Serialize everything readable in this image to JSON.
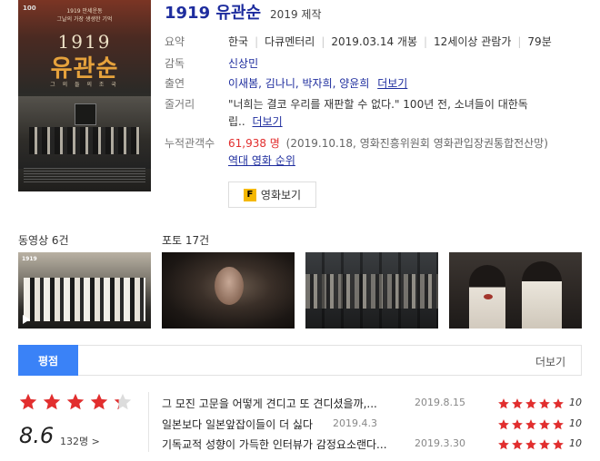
{
  "movie": {
    "title": "1919 유관순",
    "year_text": "2019 제작",
    "poster": {
      "corner": "100",
      "copy": "1919 만세운동\n그날의 가장 생생한 기억",
      "year": "1919",
      "title": "유관순",
      "subtitle": "그 의 들 의 조 국"
    },
    "summary": {
      "label": "요약",
      "country": "한국",
      "genre": "다큐멘터리",
      "release": "2019.03.14 개봉",
      "rating": "12세이상 관람가",
      "runtime": "79분"
    },
    "director": {
      "label": "감독",
      "name": "신상민"
    },
    "cast": {
      "label": "출연",
      "names": "이새봄, 김나니, 박자희, 양윤희",
      "more": "더보기"
    },
    "plot": {
      "label": "줄거리",
      "line1": "\"너희는 결코 우리를 재판할 수 없다.\" 100년 전, 소녀들이 대한독",
      "line2": "립..",
      "more": "더보기"
    },
    "audience": {
      "label": "누적관객수",
      "count": "61,938 명",
      "source": "(2019.10.18, 영화진흥위원회 영화관입장권통합전산망)",
      "ranking_link": "역대 영화 순위"
    },
    "watch_button": {
      "icon": "F",
      "label": "영화보기"
    }
  },
  "media": {
    "videos_label": "동영상 6건",
    "photos_label": "포토 17건",
    "video_caption": "1919"
  },
  "rating": {
    "tab_label": "평점",
    "more_label": "더보기",
    "stars": 4.3,
    "score": "8.6",
    "count": "132명 >",
    "reviews": [
      {
        "text": "그 모진 고문을 어떻게 견디고 또 견디셨을까,...",
        "date": "2019.8.15",
        "stars": 5,
        "score": "10"
      },
      {
        "text": "일본보다 일본앞잡이들이 더 싫다",
        "date": "2019.4.3",
        "stars": 5,
        "score": "10"
      },
      {
        "text": "기독교적 성향이 가득한 인터뷰가 감정요소랜다...",
        "date": "2019.3.30",
        "stars": 5,
        "score": "10"
      }
    ]
  },
  "colors": {
    "title": "#1e2d9e",
    "accent_red": "#e22e2e",
    "tab_blue": "#3a82f7",
    "star_empty": "#dcdcdc"
  }
}
